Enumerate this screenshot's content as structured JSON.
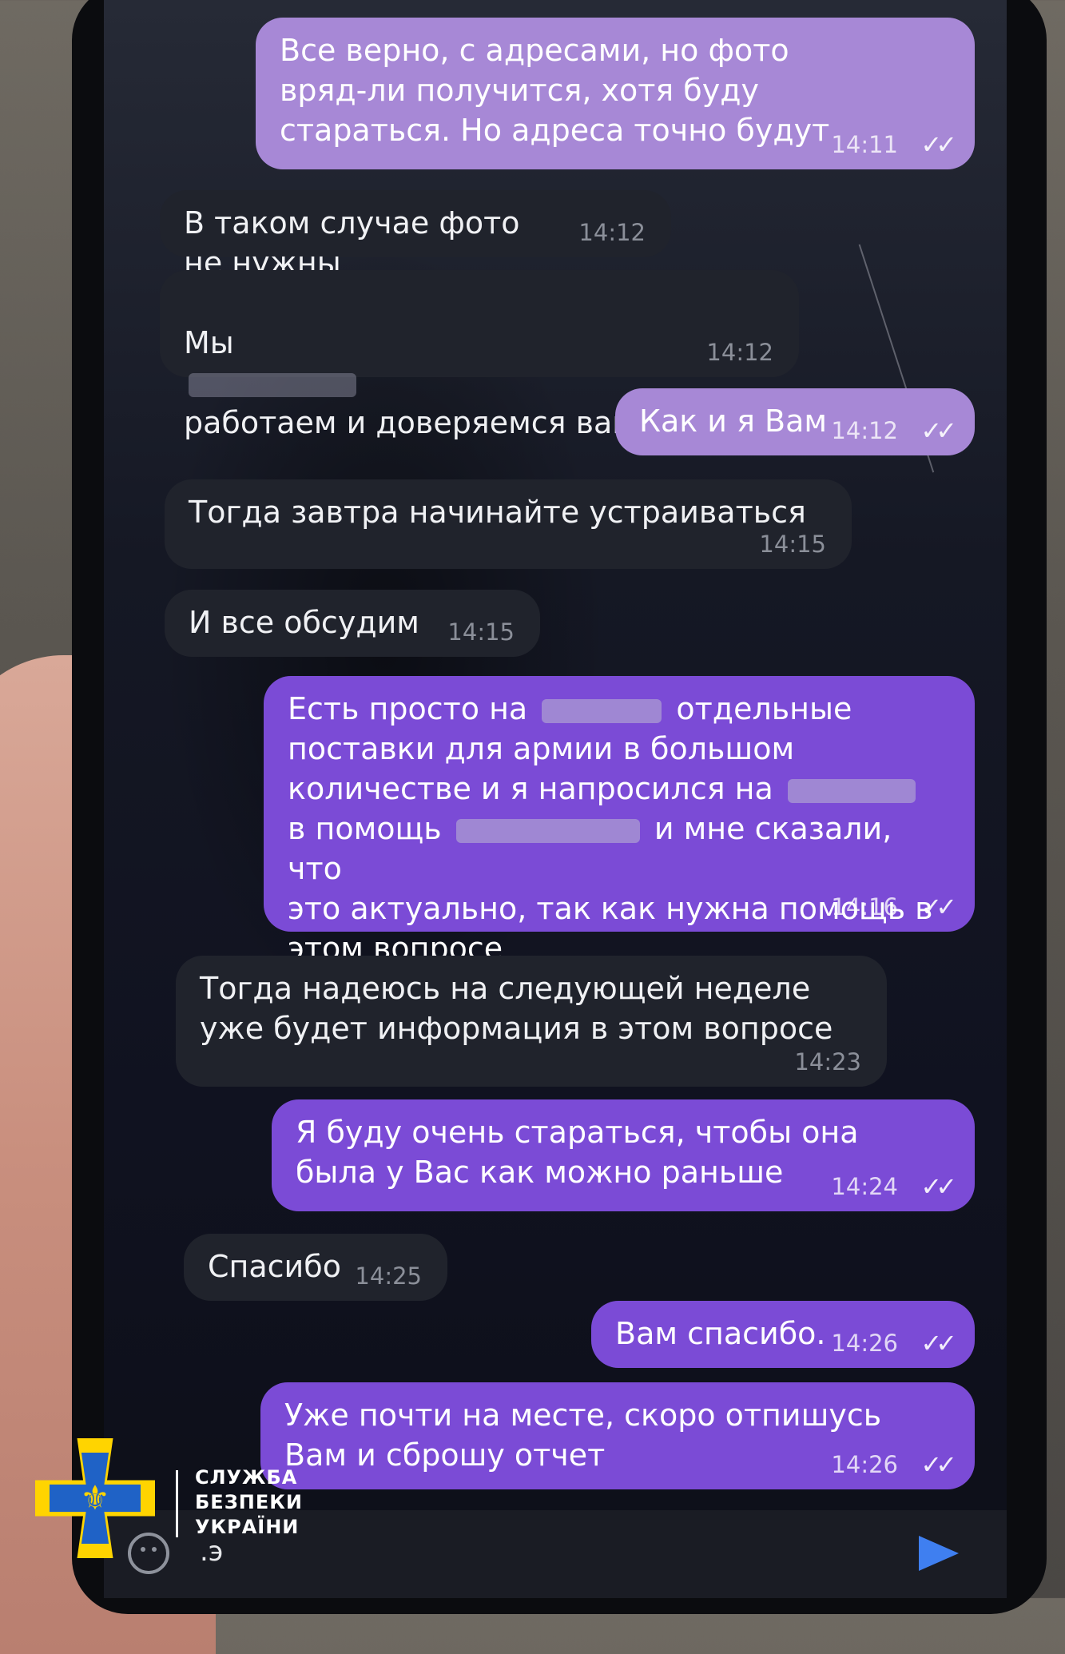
{
  "messages": [
    {
      "dir": "out",
      "text": "Все верно, с адресами, но фото вряд-ли получится, хотя буду стараться. Но адреса точно будут",
      "time": "14:11"
    },
    {
      "dir": "in",
      "text": "В таком случае фото не нужны",
      "time": "14:12"
    },
    {
      "dir": "in",
      "text_a": "Мы",
      "text_b": "работаем и доверяемся вам",
      "time": "14:12"
    },
    {
      "dir": "out",
      "text": "Как и я Вам",
      "time": "14:12"
    },
    {
      "dir": "in",
      "text": "Тогда завтра начинайте устраиваться",
      "time": "14:15"
    },
    {
      "dir": "in",
      "text": "И все обсудим",
      "time": "14:15"
    },
    {
      "dir": "out",
      "line1_a": "Есть просто на",
      "line1_b": "отдельные",
      "line2": "поставки для армии в большом",
      "line3_a": "количестве и я напросился на",
      "line4_a": "в помощь",
      "line4_b": "и мне сказали, что",
      "line5": "это актуально, так как нужна помощь в",
      "line6": "этом вопросе",
      "time": "14:16"
    },
    {
      "dir": "in",
      "text": "Тогда надеюсь на следующей неделе уже будет информация в этом вопросе",
      "time": "14:23"
    },
    {
      "dir": "out",
      "text": "Я буду очень стараться, чтобы она была у Вас как можно раньше",
      "time": "14:24"
    },
    {
      "dir": "in",
      "text": "Спасибо",
      "time": "14:25"
    },
    {
      "dir": "out",
      "text": "Вам спасибо.",
      "time": "14:26"
    },
    {
      "dir": "out",
      "text": "Уже почти на месте, скоро отпишусь Вам и сброшу отчет",
      "time": "14:26"
    }
  ],
  "input": {
    "draft": ".э"
  },
  "read_ticks": "✓✓",
  "watermark": {
    "text": "СЛУЖБА\nБЕЗПЕКИ\nУКРАЇНИ",
    "emblem": "⚜"
  },
  "colors": {
    "outgoing": "#7b4bd6",
    "incoming": "#20232c",
    "send": "#3f7ff0",
    "emblem_blue": "#1f62c6",
    "emblem_gold": "#ffd400"
  },
  "icons": [
    "emoji-icon",
    "send-icon",
    "double-check-icon",
    "sbu-emblem-icon"
  ]
}
